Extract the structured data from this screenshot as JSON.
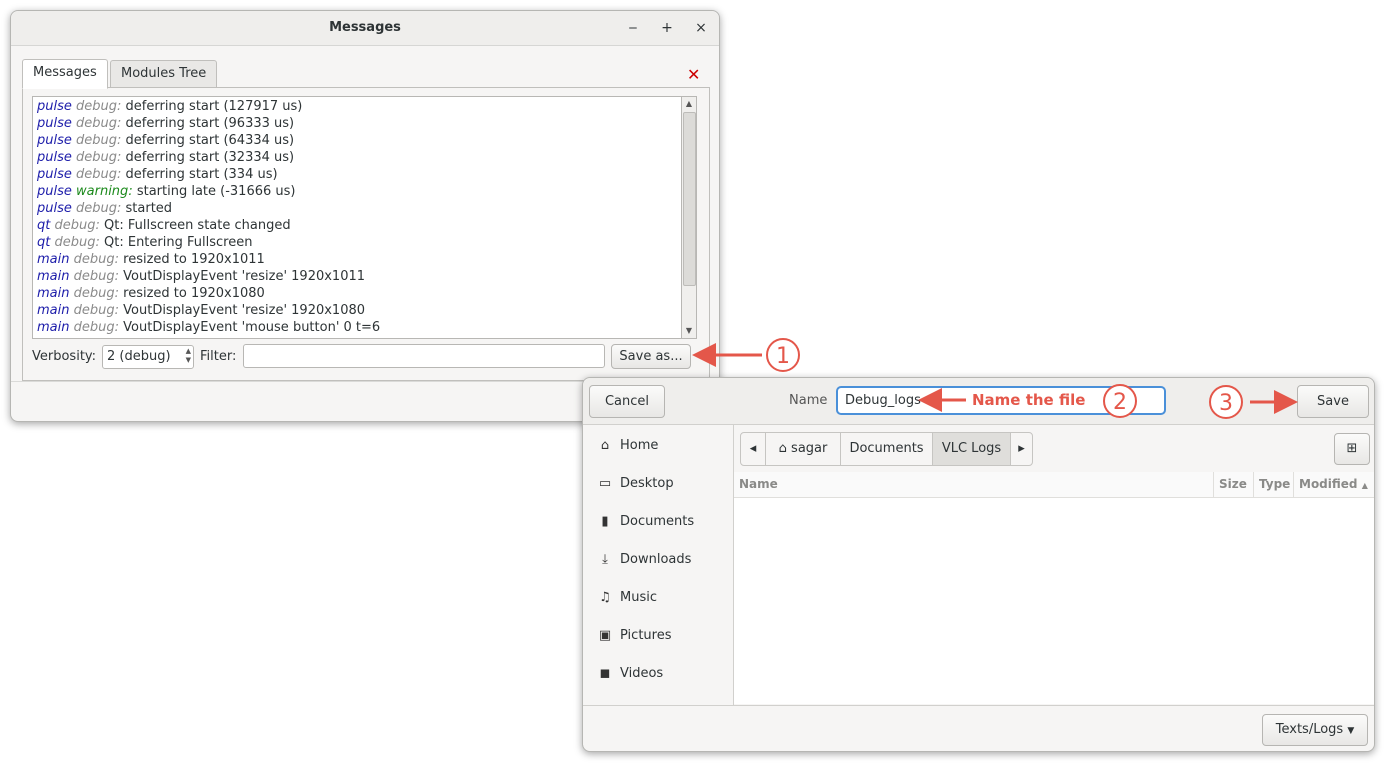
{
  "messages_window": {
    "title": "Messages",
    "controls": {
      "minimize": "‒",
      "maximize": "+",
      "close": "×"
    },
    "tabs": [
      {
        "label": "Messages",
        "active": true
      },
      {
        "label": "Modules Tree",
        "active": false
      }
    ],
    "close_panel": "✕",
    "log_lines": [
      {
        "module": "pulse",
        "level": "debug",
        "text": "deferring start (127917 us)"
      },
      {
        "module": "pulse",
        "level": "debug",
        "text": "deferring start (96333 us)"
      },
      {
        "module": "pulse",
        "level": "debug",
        "text": "deferring start (64334 us)"
      },
      {
        "module": "pulse",
        "level": "debug",
        "text": "deferring start (32334 us)"
      },
      {
        "module": "pulse",
        "level": "debug",
        "text": "deferring start (334 us)"
      },
      {
        "module": "pulse",
        "level": "warning",
        "text": "starting late (-31666 us)"
      },
      {
        "module": "pulse",
        "level": "debug",
        "text": "started"
      },
      {
        "module": "qt",
        "level": "debug",
        "text": "Qt: Fullscreen state changed"
      },
      {
        "module": "qt",
        "level": "debug",
        "text": "Qt: Entering Fullscreen"
      },
      {
        "module": "main",
        "level": "debug",
        "text": "resized to 1920x1011"
      },
      {
        "module": "main",
        "level": "debug",
        "text": "VoutDisplayEvent 'resize' 1920x1011"
      },
      {
        "module": "main",
        "level": "debug",
        "text": "resized to 1920x1080"
      },
      {
        "module": "main",
        "level": "debug",
        "text": "VoutDisplayEvent 'resize' 1920x1080"
      },
      {
        "module": "main",
        "level": "debug",
        "text": "VoutDisplayEvent 'mouse button' 0 t=6"
      }
    ],
    "verbosity_label": "Verbosity:",
    "verbosity_value": "2 (debug)",
    "filter_label": "Filter:",
    "filter_value": "",
    "save_as_label": "Save as..."
  },
  "save_dialog": {
    "cancel_label": "Cancel",
    "name_label": "Name",
    "name_value": "Debug_logs",
    "save_label": "Save",
    "sidebar": [
      {
        "icon": "home-icon",
        "glyph": "⌂",
        "label": "Home"
      },
      {
        "icon": "desktop-icon",
        "glyph": "▭",
        "label": "Desktop"
      },
      {
        "icon": "documents-icon",
        "glyph": "▮",
        "label": "Documents"
      },
      {
        "icon": "downloads-icon",
        "glyph": "⤓",
        "label": "Downloads"
      },
      {
        "icon": "music-icon",
        "glyph": "♫",
        "label": "Music"
      },
      {
        "icon": "pictures-icon",
        "glyph": "▣",
        "label": "Pictures"
      },
      {
        "icon": "videos-icon",
        "glyph": "◼",
        "label": "Videos"
      }
    ],
    "breadcrumbs": [
      "sagar",
      "Documents",
      "VLC Logs"
    ],
    "columns": {
      "name": "Name",
      "size": "Size",
      "type": "Type",
      "modified": "Modified"
    },
    "file_type": "Texts/Logs"
  },
  "annotations": {
    "step1": "1",
    "step2": "2",
    "step3": "3",
    "name_hint": "Name the file"
  },
  "colors": {
    "annotation": "#e4574a",
    "focus": "#4a90d9",
    "module": "#1d1daa",
    "warning": "#1c8a1c"
  }
}
